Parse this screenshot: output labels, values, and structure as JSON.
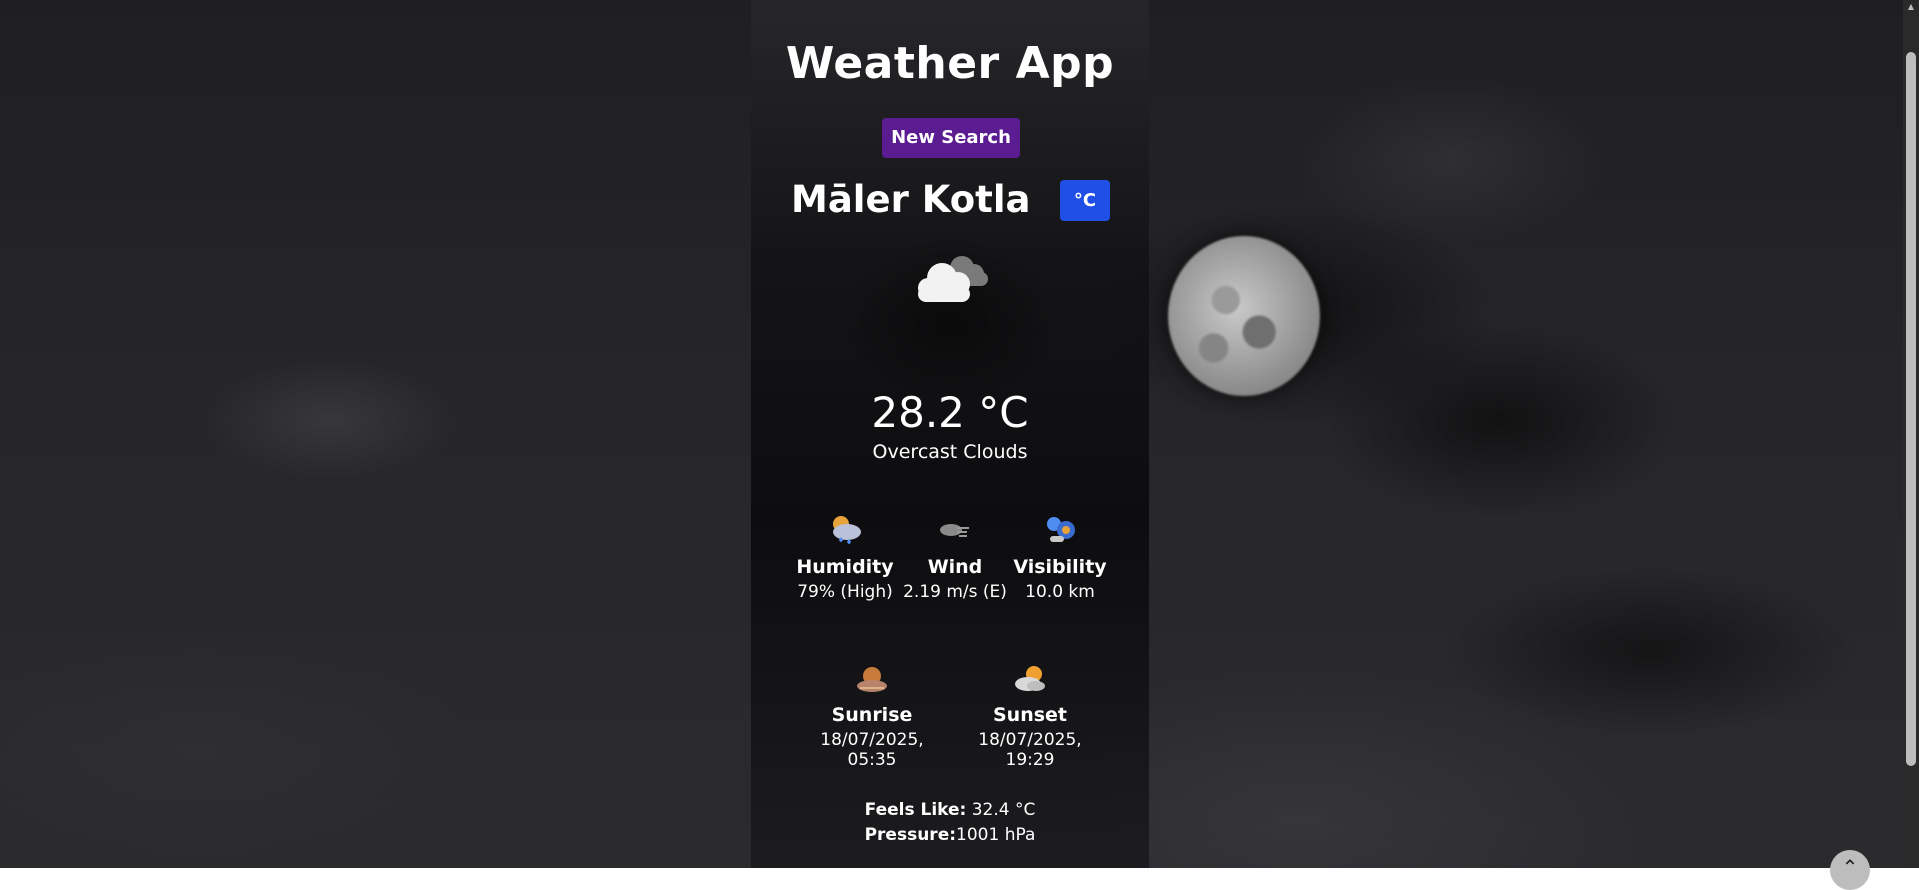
{
  "app": {
    "title": "Weather App",
    "new_search_label": "New Search",
    "unit_toggle_label": "°C"
  },
  "location": {
    "city": "Māler Kotla"
  },
  "current": {
    "icon": "overcast-clouds-icon",
    "temperature": "28.2 °C",
    "description": "Overcast Clouds"
  },
  "stats": [
    {
      "icon": "humidity-icon",
      "label": "Humidity",
      "value": "79% (High)"
    },
    {
      "icon": "wind-icon",
      "label": "Wind",
      "value": "2.19 m/s (E)"
    },
    {
      "icon": "visibility-icon",
      "label": "Visibility",
      "value": "10.0 km"
    }
  ],
  "sun": [
    {
      "icon": "sunrise-icon",
      "label": "Sunrise",
      "value": "18/07/2025, 05:35"
    },
    {
      "icon": "sunset-icon",
      "label": "Sunset",
      "value": "18/07/2025, 19:29"
    }
  ],
  "details": {
    "feels_like_label": "Feels Like:",
    "feels_like_value": " 32.4 °C",
    "pressure_label": "Pressure:",
    "pressure_value": "1001 hPa"
  },
  "colors": {
    "new_search_bg": "#5b1b91",
    "unit_toggle_bg": "#1f4fe6"
  }
}
